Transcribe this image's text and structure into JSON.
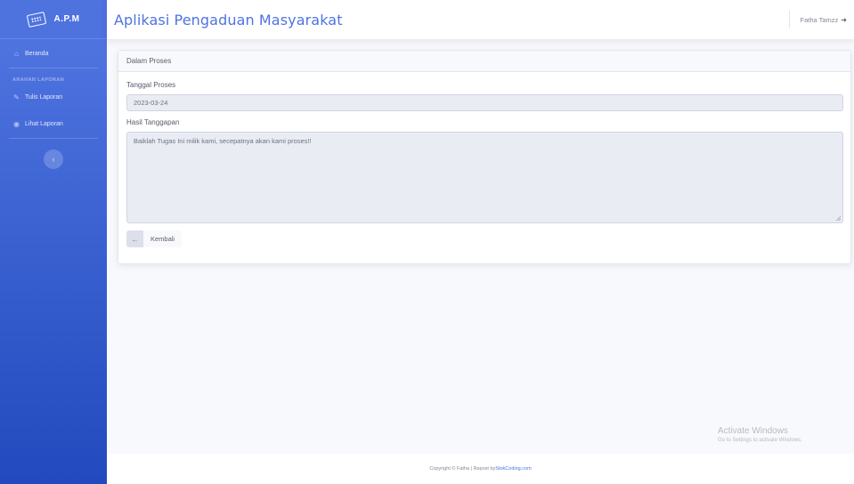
{
  "sidebar": {
    "brand": "A.P.M",
    "items": [
      {
        "label": "Beranda",
        "icon": "home-icon"
      },
      {
        "label": "Tulis Laporan",
        "icon": "edit-icon"
      },
      {
        "label": "Lihat Laporan",
        "icon": "eye-icon"
      }
    ],
    "heading": "ARAHAN LAPORAN",
    "toggle_icon": "chevron-left-icon"
  },
  "topbar": {
    "title": "Aplikasi Pengaduan Masyarakat",
    "user_name": "Fatha Tamzz",
    "user_icon": "sign-out-icon"
  },
  "card": {
    "header": "Dalam Proses",
    "date_label": "Tanggal Proses",
    "date_value": "2023-03-24",
    "response_label": "Hasil Tanggapan",
    "response_value": "Baiklah Tugas Ini milik kami, secepatnya akan kami proses!!",
    "back_button": "Kembali",
    "back_icon": "arrow-left-icon"
  },
  "watermark": {
    "line1": "Activate Windows",
    "line2": "Go to Settings to activate Windows."
  },
  "footer": {
    "text": "Copyright © Fatha | Repost by ",
    "link": "StokCoding.com"
  },
  "colors": {
    "primary": "#4e73df",
    "sidebar_bottom": "#224abe",
    "background": "#f8f9fc",
    "field_bg": "#eaecf4"
  }
}
